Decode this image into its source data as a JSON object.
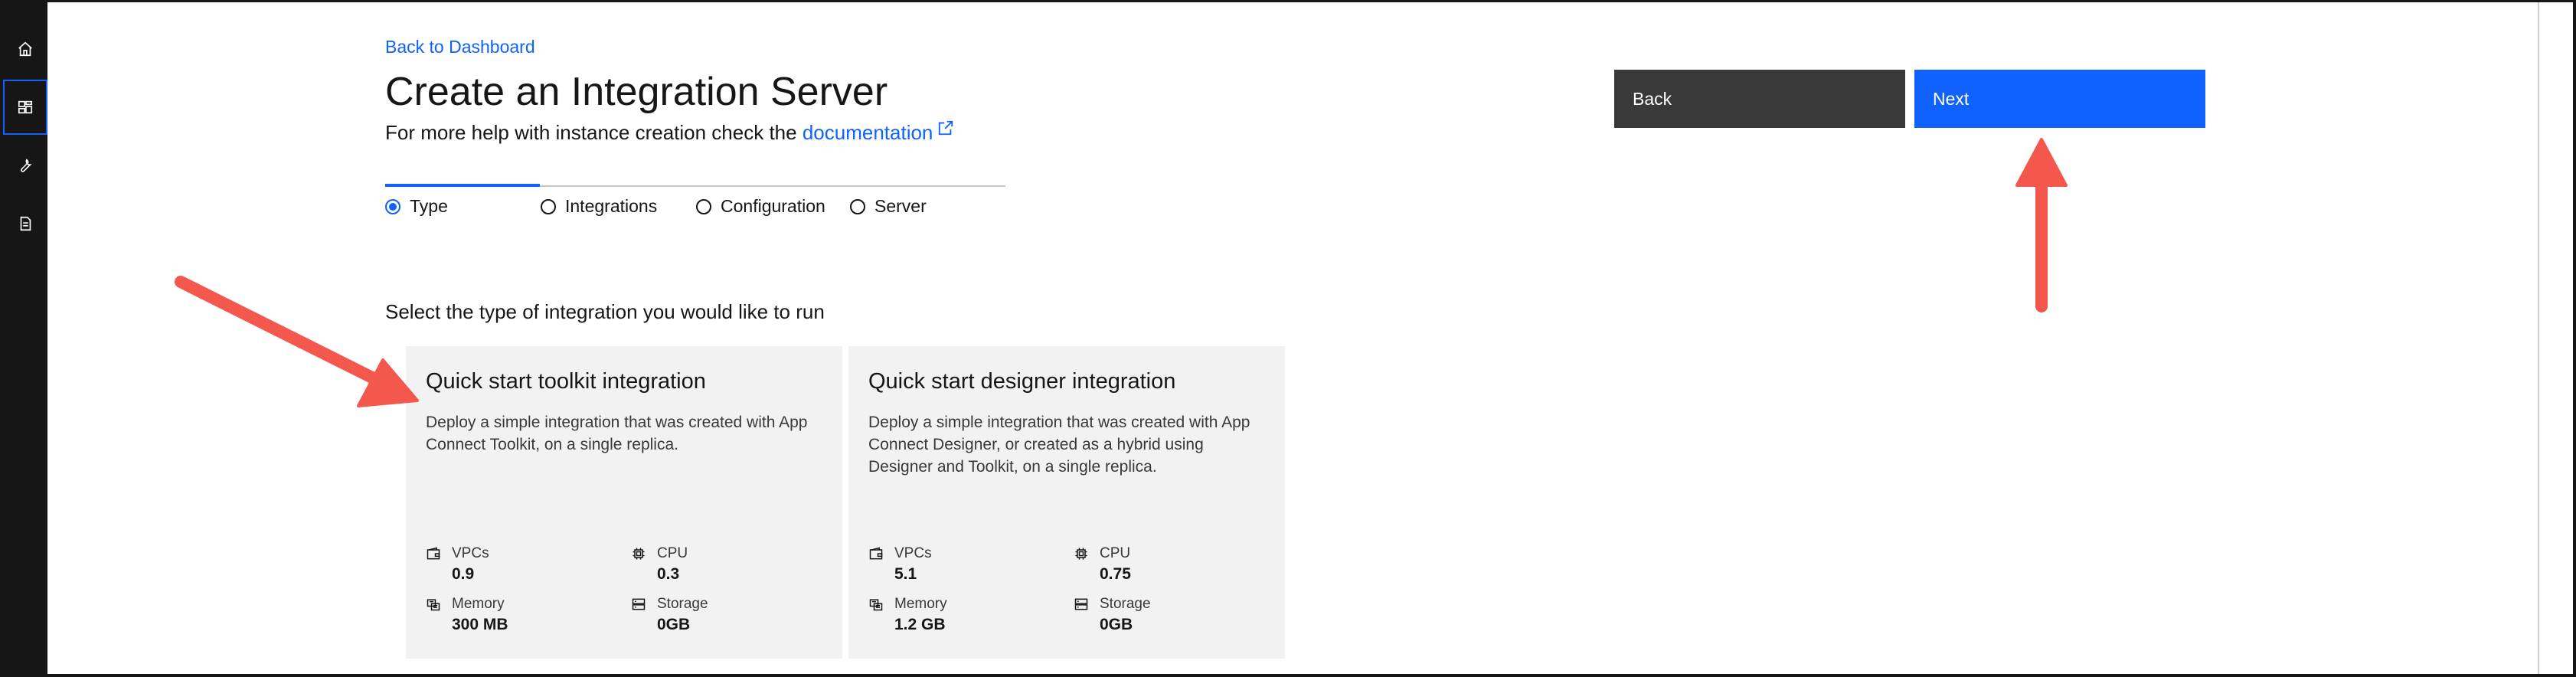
{
  "nav": {
    "back_to_dashboard": "Back to Dashboard"
  },
  "page": {
    "title": "Create an Integration Server",
    "help_prefix": "For more help with instance creation check the ",
    "help_link": "documentation"
  },
  "steps": [
    {
      "label": "Type",
      "selected": true
    },
    {
      "label": "Integrations",
      "selected": false
    },
    {
      "label": "Configuration",
      "selected": false
    },
    {
      "label": "Server",
      "selected": false
    }
  ],
  "buttons": {
    "back": "Back",
    "next": "Next"
  },
  "instruction": "Select the type of integration you would like to run",
  "tiles": [
    {
      "title": "Quick start toolkit integration",
      "description": "Deploy a simple integration that was created with App Connect Toolkit, on a single replica.",
      "vpcs_label": "VPCs",
      "vpcs_value": "0.9",
      "cpu_label": "CPU",
      "cpu_value": "0.3",
      "memory_label": "Memory",
      "memory_value": "300 MB",
      "storage_label": "Storage",
      "storage_value": "0GB"
    },
    {
      "title": "Quick start designer integration",
      "description": "Deploy a simple integration that was created with App Connect Designer, or created as a hybrid using Designer and Toolkit, on a single replica.",
      "vpcs_label": "VPCs",
      "vpcs_value": "5.1",
      "cpu_label": "CPU",
      "cpu_value": "0.75",
      "memory_label": "Memory",
      "memory_value": "1.2 GB",
      "storage_label": "Storage",
      "storage_value": "0GB"
    }
  ],
  "colors": {
    "accent": "#0f62fe",
    "annotation_arrow": "#f4574b",
    "rail": "#161616"
  },
  "icons": {
    "rail": [
      "home-icon",
      "dashboard-icon",
      "wrench-icon",
      "document-icon"
    ]
  }
}
